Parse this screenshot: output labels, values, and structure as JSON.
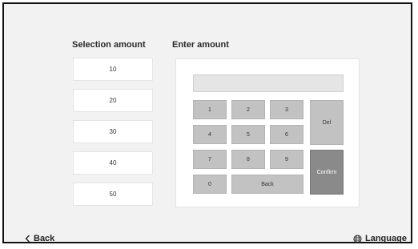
{
  "selection": {
    "title": "Selection amount",
    "amounts": [
      "10",
      "20",
      "30",
      "40",
      "50"
    ]
  },
  "enter": {
    "title": "Enter amount",
    "display_value": "",
    "keys": {
      "k1": "1",
      "k2": "2",
      "k3": "3",
      "k4": "4",
      "k5": "5",
      "k6": "6",
      "k7": "7",
      "k8": "8",
      "k9": "9",
      "k0": "0",
      "del": "Del",
      "back": "Back",
      "confirm": "Confirm"
    }
  },
  "footer": {
    "back_label": "Back",
    "language_label": "Language",
    "back_icon": "chevron-left-icon",
    "language_icon": "globe-icon"
  },
  "colors": {
    "key": "#c2c2c2",
    "confirm": "#8a8a8a",
    "panel": "#ffffff",
    "background": "#f2f2f2"
  }
}
